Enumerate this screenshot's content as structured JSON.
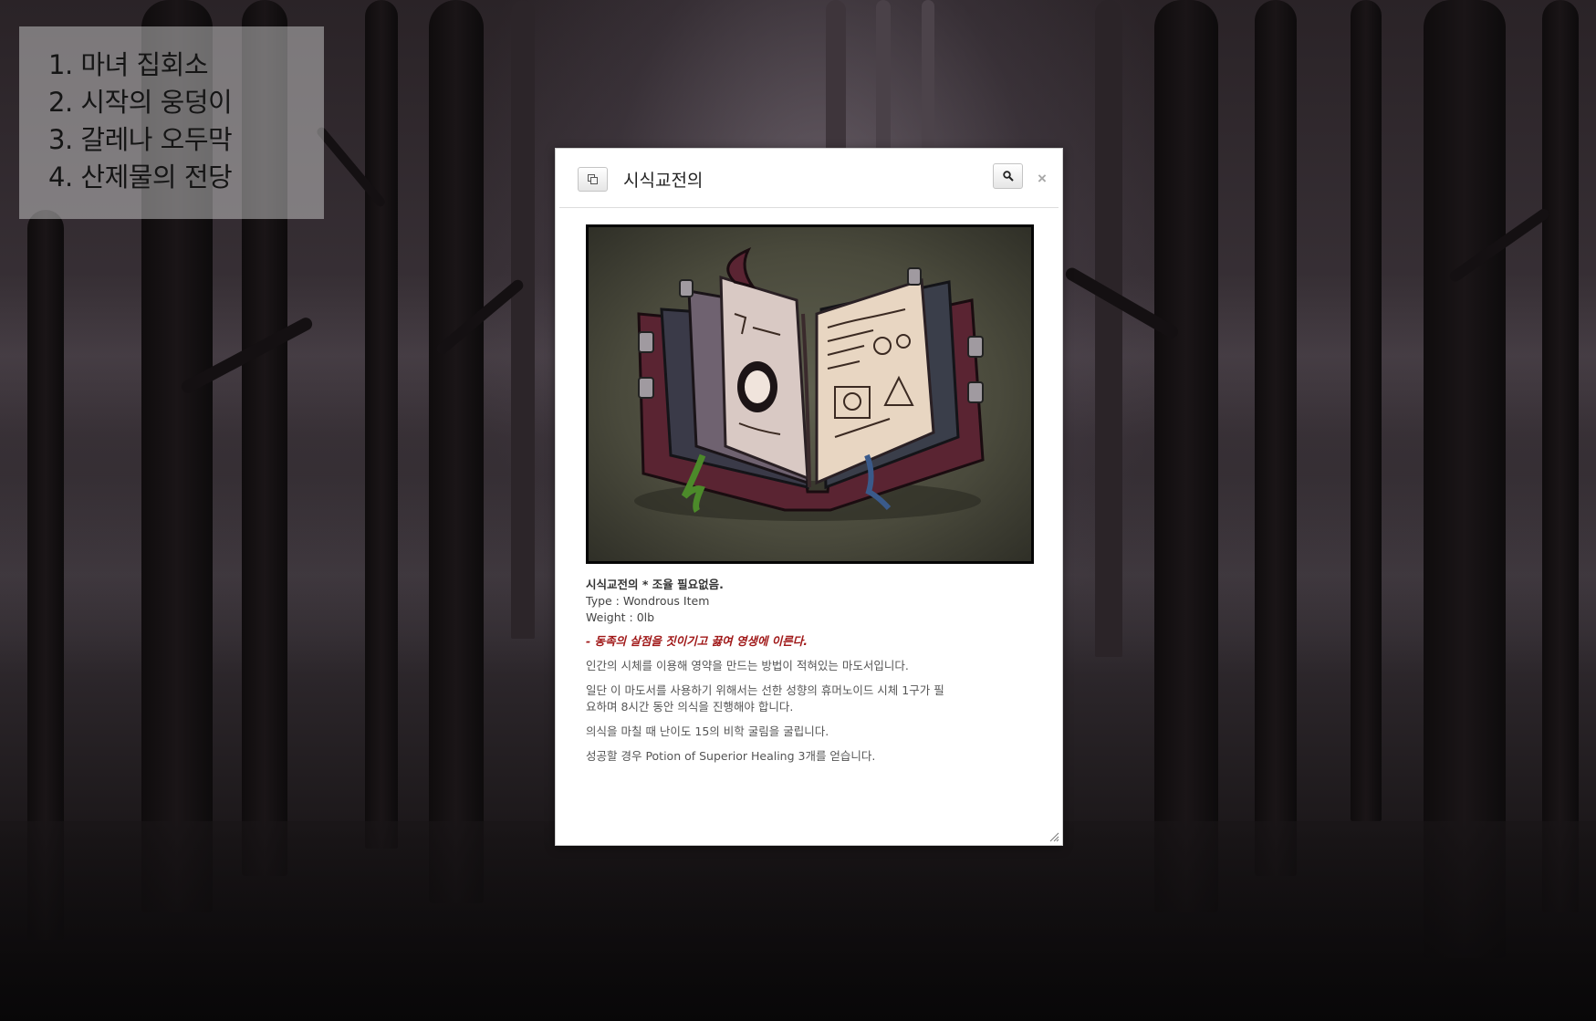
{
  "locations": [
    "1. 마녀 집회소",
    "2. 시작의 웅덩이",
    "3. 갈레나 오두막",
    "4. 산제물의 전당"
  ],
  "dialog": {
    "title": "시식교전의",
    "close_symbol": "×",
    "icons": {
      "copy": "copy-icon",
      "search": "search-icon",
      "close": "close-icon",
      "resize": "resize-grip-icon"
    },
    "item": {
      "image": "open-spellbook",
      "name_line": "시식교전의 * 조율 필요없음.",
      "type_line": "Type : Wondrous Item",
      "weight_line": "Weight : 0lb",
      "quote": "- 동족의 살점을 짓이기고 끓여 영생에 이른다.",
      "descriptions": [
        "인간의 시체를 이용해 영약을 만드는 방법이 적혀있는 마도서입니다.",
        "일단 이 마도서를 사용하기 위해서는 선한 성향의 휴머노이드 시체 1구가 필요하며 8시간 동안 의식을 진행해야 합니다.",
        "의식을 마칠 때 난이도 15의 비학 굴림을 굴립니다.",
        "성공할 경우 Potion of Superior Healing 3개를 얻습니다."
      ]
    }
  },
  "colors": {
    "quote": "#a01818",
    "dialog_bg": "#ffffff",
    "panel_bg": "rgba(205,205,205,0.5)"
  }
}
